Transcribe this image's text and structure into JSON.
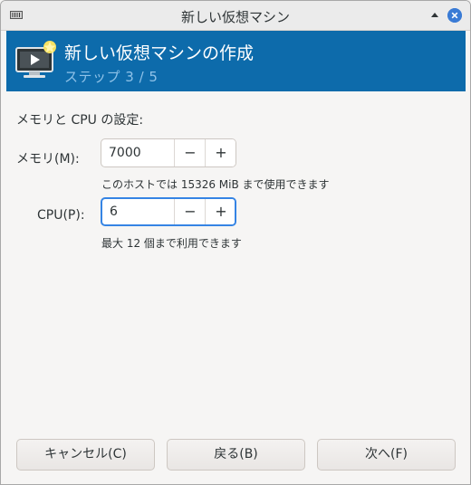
{
  "window": {
    "title": "新しい仮想マシン",
    "app_icon": "virt-manager-icon",
    "minimize_icon": "chevron-up-icon",
    "close_icon": "close-icon"
  },
  "banner": {
    "heading": "新しい仮想マシンの作成",
    "step": "ステップ 3 / 5",
    "icon": "new-vm-icon",
    "color": "#0d6bab"
  },
  "section_title": "メモリと CPU の設定:",
  "memory": {
    "label": "メモリ(M):",
    "value": "7000",
    "decrement": "−",
    "increment": "+",
    "hint": "このホストでは 15326 MiB まで使用できます"
  },
  "cpu": {
    "label": "CPU(P):",
    "value": "6",
    "decrement": "−",
    "increment": "+",
    "hint": "最大 12 個まで利用できます"
  },
  "buttons": {
    "cancel": "キャンセル(C)",
    "back": "戻る(B)",
    "next": "次へ(F)"
  },
  "colors": {
    "accent": "#3584e4",
    "banner": "#0d6bab"
  }
}
